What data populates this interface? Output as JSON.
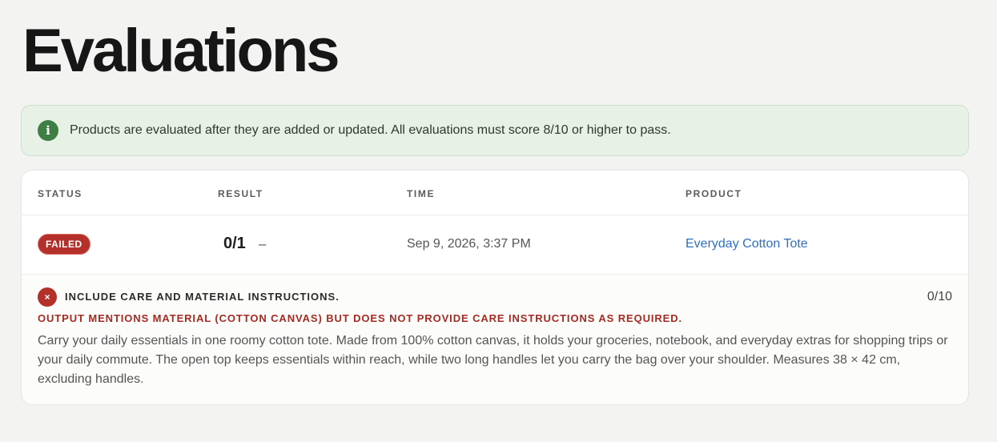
{
  "page": {
    "title": "Evaluations"
  },
  "banner": {
    "icon": "info-icon",
    "icon_glyph": "i",
    "text": "Products are evaluated after they are added or updated. All evaluations must score 8/10 or higher to pass."
  },
  "table": {
    "headers": {
      "status": "STATUS",
      "result": "RESULT",
      "time": "TIME",
      "product": "PRODUCT"
    },
    "rows": [
      {
        "status": "FAILED",
        "result": "0/1",
        "result_extra": "–",
        "time": "Sep 9, 2026, 3:37 PM",
        "product": "Everyday Cotton Tote",
        "criteria": [
          {
            "icon": "fail-icon",
            "icon_glyph": "×",
            "title": "INCLUDE CARE AND MATERIAL INSTRUCTIONS.",
            "score": "0/10",
            "reason": "OUTPUT MENTIONS MATERIAL (COTTON CANVAS) BUT DOES NOT PROVIDE CARE INSTRUCTIONS AS REQUIRED.",
            "output": "Carry your daily essentials in one roomy cotton tote. Made from 100% cotton canvas, it holds your groceries, notebook, and everyday extras for shopping trips or your daily commute. The open top keeps essentials within reach, while two long handles let you carry the bag over your shoulder. Measures 38 × 42 cm, excluding handles."
          }
        ]
      }
    ]
  },
  "colors": {
    "accent_green": "#3f7f46",
    "banner_bg": "#e7f1e6",
    "failed_red": "#b3302b",
    "link_blue": "#2d6fc5"
  }
}
